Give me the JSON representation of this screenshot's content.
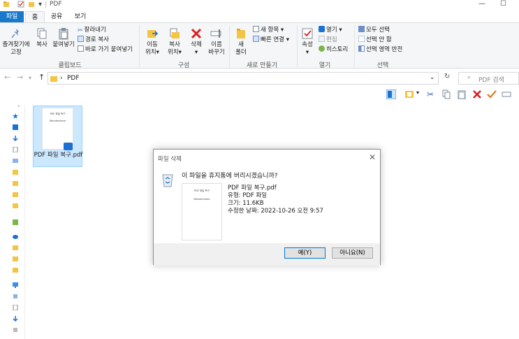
{
  "window": {
    "title": "PDF",
    "minimize": "—",
    "maximize": "☐"
  },
  "tabs": [
    "파일",
    "홈",
    "공유",
    "보기"
  ],
  "ribbon": {
    "clipboard": {
      "pin_label_1": "즐겨찾기에",
      "pin_label_2": "고정",
      "copy_label": "복사",
      "paste_label": "붙여넣기",
      "cut_label": "잘라내기",
      "copy_path_label": "경로 복사",
      "paste_shortcut_label": "바로 가기 붙여넣기",
      "group_label": "클립보드"
    },
    "organize": {
      "move_1": "이동",
      "move_2": "위치",
      "copyto_1": "복사",
      "copyto_2": "위치",
      "delete": "삭제",
      "rename_1": "이름",
      "rename_2": "바꾸기",
      "group_label": "구성"
    },
    "new": {
      "new_folder_1": "새",
      "new_folder_2": "폴더",
      "new_item": "새 항목",
      "easy_access": "빠른 연결",
      "group_label": "새로 만들기"
    },
    "open": {
      "properties": "속성",
      "open": "열기",
      "edit": "편집",
      "history": "히스토리",
      "group_label": "열기"
    },
    "select": {
      "select_all": "모두 선택",
      "select_none": "선택 안 함",
      "invert": "선택 영역 반전",
      "group_label": "선택"
    }
  },
  "address": {
    "path_sep": "›",
    "path": "PDF",
    "search_placeholder": "PDF 검색"
  },
  "file": {
    "name": "PDF 파일 복구.pdf",
    "thumb_title": "PDF 파일 복구",
    "thumb_sub": "Wondershare"
  },
  "dialog": {
    "title": "파일 삭제",
    "question": "이 파일을 휴지통에 버리시겠습니까?",
    "info_name": "PDF 파일 복구.pdf",
    "info_type": "유형: PDF 파일",
    "info_size": "크기: 11.6KB",
    "info_date": "수정한 날짜: 2022-10-26 오전 9:57",
    "yes_label": "예(Y)",
    "no_label": "아니요(N)"
  },
  "colors": {
    "accent": "#1979ca",
    "selection": "#cce8ff",
    "delete_red": "#d81f26",
    "folder": "#f4c443"
  }
}
